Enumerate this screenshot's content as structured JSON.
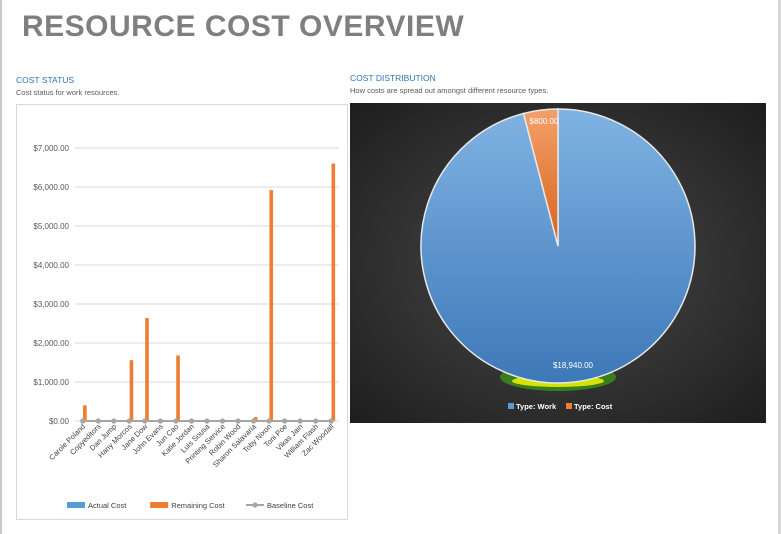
{
  "page": {
    "title": "RESOURCE COST OVERVIEW",
    "cost_status": {
      "title": "COST STATUS",
      "subtitle": "Cost status for work resources."
    },
    "cost_distribution": {
      "title": "COST DISTRIBUTION",
      "subtitle": "How costs are spread out amongst different resource types."
    }
  },
  "chart_data": [
    {
      "type": "bar",
      "title": "",
      "xlabel": "",
      "ylabel": "",
      "ylim": [
        0,
        7000
      ],
      "yticks": [
        "$0.00",
        "$1,000.00",
        "$2,000.00",
        "$3,000.00",
        "$4,000.00",
        "$5,000.00",
        "$6,000.00",
        "$7,000.00"
      ],
      "ytick_values": [
        0,
        1000,
        2000,
        3000,
        4000,
        5000,
        6000,
        7000
      ],
      "grid": true,
      "legend_position": "bottom",
      "categories": [
        "Carole Poland",
        "Copyeditors",
        "Dan Jump",
        "Hany Morcos",
        "Jane Dow",
        "John Evans",
        "Jun Cao",
        "Katie Jordan",
        "Luis Sousa",
        "Printing Service",
        "Robin Wood",
        "Sharon Salavaria",
        "Toby Nixon",
        "Toni Poe",
        "Vikas Jain",
        "William Flash",
        "Zac Woodall"
      ],
      "series": [
        {
          "name": "Actual Cost",
          "kind": "bar",
          "color": "#5b9bd5",
          "values": [
            0,
            0,
            0,
            0,
            0,
            0,
            0,
            0,
            0,
            0,
            0,
            0,
            0,
            0,
            0,
            0,
            0
          ]
        },
        {
          "name": "Remaining Cost",
          "kind": "bar",
          "color": "#ed7d31",
          "values": [
            400,
            0,
            0,
            1560,
            2640,
            0,
            1680,
            0,
            0,
            0,
            0,
            100,
            5920,
            0,
            0,
            0,
            6600
          ]
        },
        {
          "name": "Baseline Cost",
          "kind": "line",
          "color": "#a5a5a5",
          "values": [
            0,
            0,
            0,
            0,
            0,
            0,
            0,
            0,
            0,
            0,
            0,
            0,
            0,
            0,
            0,
            0,
            0
          ]
        }
      ]
    },
    {
      "type": "pie",
      "title": "",
      "legend_position": "bottom",
      "background": "#2b2b2b",
      "slices": [
        {
          "name": "Type: Work",
          "value": 18940,
          "label": "$18,940.00",
          "color": "#5b9bd5"
        },
        {
          "name": "Type: Cost",
          "value": 800,
          "label": "$800.00",
          "color": "#ed7d31"
        }
      ]
    }
  ]
}
